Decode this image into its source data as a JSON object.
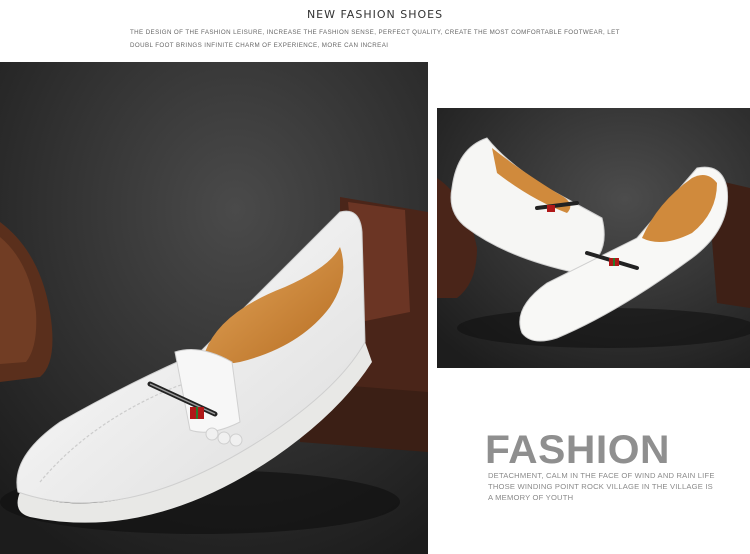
{
  "header": {
    "title": "NEW FASHION SHOES",
    "subtitle": "THE DESIGN OF THE FASHION LEISURE, INCREASE THE FASHION SENSE, PERFECT QUALITY, CREATE THE MOST COMFORTABLE FOOTWEAR, LET DOUBL FOOT BRINGS INFINITE CHARM OF EXPERIENCE, MORE CAN INCREAI"
  },
  "promo": {
    "heading": "FASHION",
    "body": "DETACHMENT, CALM IN THE FACE OF WIND AND RAIN LIFE THOSE WINDING POINT ROCK VILLAGE IN THE VILLAGE IS A MEMORY OF YOUTH"
  },
  "photos": {
    "main": "white-loafer-single-photo",
    "side": "white-loafer-pair-photo"
  },
  "colors": {
    "background": "#ffffff",
    "photo_background": "#2a2a2a",
    "shoe_leather": "#f4f4f2",
    "shoe_lining": "#d08a3c",
    "heading_gray": "#8f8f8f"
  }
}
